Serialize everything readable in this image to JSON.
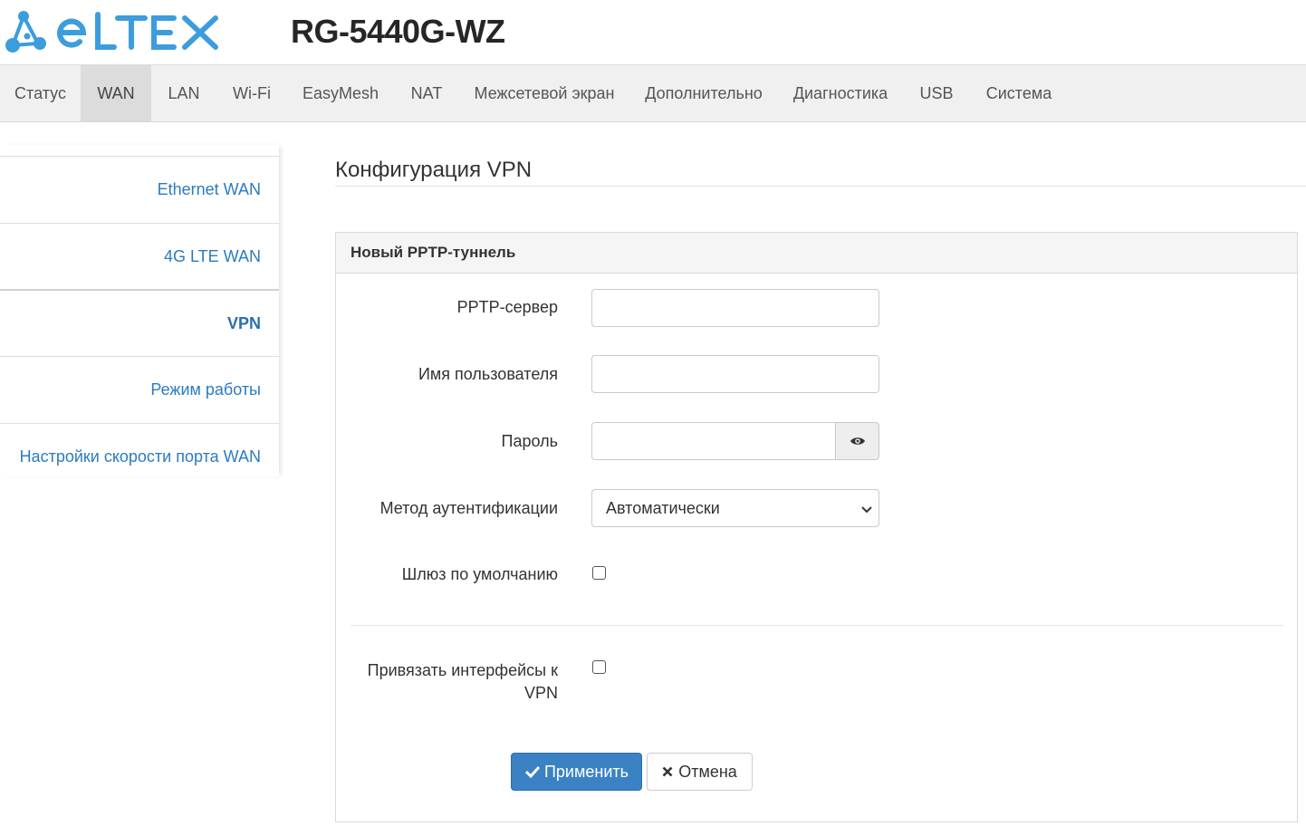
{
  "header": {
    "brand": "ELTEX",
    "model": "RG-5440G-WZ",
    "brand_color": "#3b9ddd"
  },
  "nav": {
    "items": [
      {
        "label": "Статус"
      },
      {
        "label": "WAN",
        "active": true
      },
      {
        "label": "LAN"
      },
      {
        "label": "Wi-Fi"
      },
      {
        "label": "EasyMesh"
      },
      {
        "label": "NAT"
      },
      {
        "label": "Межсетевой экран"
      },
      {
        "label": "Дополнительно"
      },
      {
        "label": "Диагностика"
      },
      {
        "label": "USB"
      },
      {
        "label": "Система"
      }
    ]
  },
  "sidebar": {
    "items": [
      {
        "label": "Ethernet WAN"
      },
      {
        "label": "4G LTE WAN"
      },
      {
        "label": "VPN",
        "active": true
      },
      {
        "label": "Режим работы"
      },
      {
        "label": "Настройки скорости порта WAN"
      }
    ]
  },
  "page": {
    "title": "Конфигурация VPN"
  },
  "panel": {
    "title": "Новый PPTP-туннель",
    "fields": {
      "server": {
        "label": "PPTP-сервер",
        "value": ""
      },
      "username": {
        "label": "Имя пользователя",
        "value": ""
      },
      "password": {
        "label": "Пароль",
        "value": ""
      },
      "auth_method": {
        "label": "Метод аутентификации",
        "value": "Автоматически"
      },
      "default_gateway": {
        "label": "Шлюз по умолчанию",
        "checked": false
      },
      "bind_interfaces": {
        "label_line1": "Привязать интерфейсы к",
        "label_line2": "VPN",
        "checked": false
      }
    },
    "buttons": {
      "apply": "Применить",
      "cancel": "Отмена"
    }
  },
  "colors": {
    "link": "#2b7bc0",
    "primary_button": "#3b82c4"
  }
}
